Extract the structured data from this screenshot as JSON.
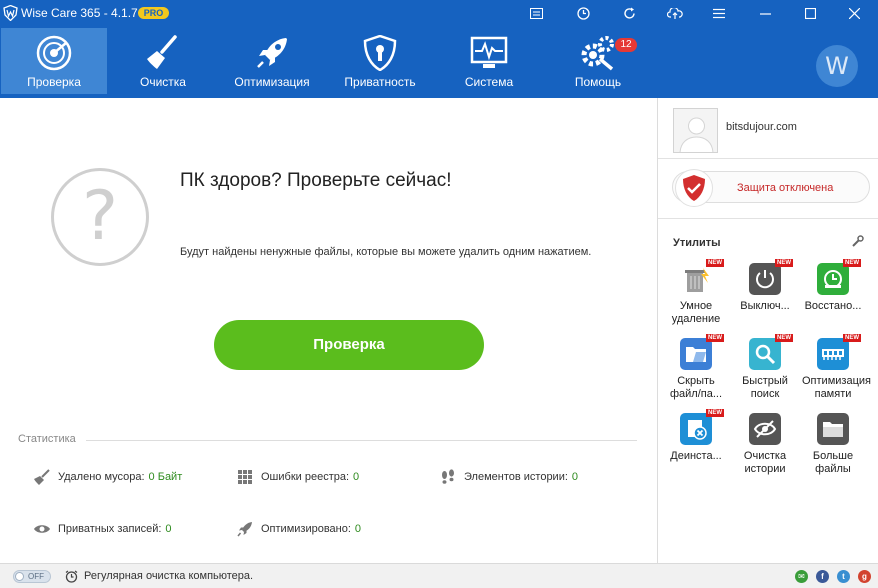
{
  "app": {
    "title": "Wise Care 365 - 4.1.7",
    "badge": "PRO",
    "brand_color": "#1662c0",
    "active_color": "#3f86d4"
  },
  "titlebar": {
    "buttons": [
      {
        "name": "message-icon"
      },
      {
        "name": "clock-icon"
      },
      {
        "name": "refresh-icon"
      },
      {
        "name": "cloud-sync-icon"
      },
      {
        "name": "menu-list-icon"
      },
      {
        "name": "minimize-icon"
      },
      {
        "name": "maximize-icon"
      },
      {
        "name": "close-icon"
      }
    ]
  },
  "nav": {
    "items": [
      {
        "label": "Проверка",
        "icon": "radar-icon",
        "active": true
      },
      {
        "label": "Очистка",
        "icon": "broom-icon"
      },
      {
        "label": "Оптимизация",
        "icon": "rocket-icon"
      },
      {
        "label": "Приватность",
        "icon": "shield-lock-icon"
      },
      {
        "label": "Система",
        "icon": "monitor-pulse-icon"
      },
      {
        "label": "Помощь",
        "icon": "gears-icon"
      }
    ],
    "help_badge": "12",
    "profile_letter": "W"
  },
  "main": {
    "headline": "ПК здоров? Проверьте сейчас!",
    "subtext": "Будут найдены ненужные файлы, которые вы можете удалить одним нажатием.",
    "scan_button": "Проверка",
    "question_mark": "?"
  },
  "stats": {
    "title": "Статистика",
    "items": [
      {
        "label": "Удалено мусора:",
        "value": "0 Байт",
        "icon": "broom-icon"
      },
      {
        "label": "Ошибки реестра:",
        "value": "0",
        "icon": "grid-icon"
      },
      {
        "label": "Элементов истории:",
        "value": "0",
        "icon": "footprints-icon"
      },
      {
        "label": "Приватных записей:",
        "value": "0",
        "icon": "eye-icon"
      },
      {
        "label": "Оптимизировано:",
        "value": "0",
        "icon": "rocket-icon"
      }
    ]
  },
  "sidebar": {
    "username": "bitsdujour.com",
    "protection": "Защита отключена",
    "utilities_title": "Утилиты",
    "utilities": [
      {
        "label1": "Умное",
        "label2": "удаление",
        "new": "NEW",
        "icon": "trash-icon",
        "color": "#ffffff"
      },
      {
        "label1": "Выключ...",
        "label2": "",
        "new": "NEW",
        "icon": "power-icon",
        "color": "#555555"
      },
      {
        "label1": "Восстано...",
        "label2": "",
        "new": "NEW",
        "icon": "restore-icon",
        "color": "#2fae3b"
      },
      {
        "label1": "Скрыть",
        "label2": "файл/па...",
        "new": "NEW",
        "icon": "folder-hide-icon",
        "color": "#3c7fd6"
      },
      {
        "label1": "Быстрый",
        "label2": "поиск",
        "new": "NEW",
        "icon": "search-icon",
        "color": "#37b4d0"
      },
      {
        "label1": "Оптимизация",
        "label2": "памяти",
        "new": "NEW",
        "icon": "memory-icon",
        "color": "#1e8fd6"
      },
      {
        "label1": "Деинста...",
        "label2": "",
        "new": "NEW",
        "icon": "uninstall-icon",
        "color": "#1e8fd6"
      },
      {
        "label1": "Очистка",
        "label2": "истории",
        "new": "",
        "icon": "eye-off-icon",
        "color": "#555555"
      },
      {
        "label1": "Больше",
        "label2": "файлы",
        "new": "",
        "icon": "large-folder-icon",
        "color": "#555555"
      }
    ]
  },
  "footer": {
    "toggle": "OFF",
    "text": "Регулярная очистка компьютера.",
    "social": [
      {
        "name": "email-icon",
        "color": "#3a9d3a",
        "glyph": "✉"
      },
      {
        "name": "facebook-icon",
        "color": "#3b5998",
        "glyph": "f"
      },
      {
        "name": "twitter-icon",
        "color": "#3a8fd1",
        "glyph": "t"
      },
      {
        "name": "google-plus-icon",
        "color": "#d2432f",
        "glyph": "g"
      }
    ]
  }
}
